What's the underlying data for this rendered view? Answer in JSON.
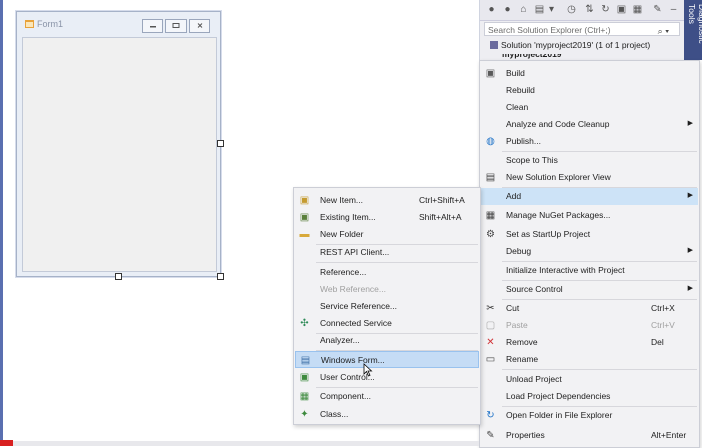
{
  "form": {
    "title": "Form1"
  },
  "solution_explorer": {
    "search_placeholder": "Search Solution Explorer (Ctrl+;)",
    "solution_label": "Solution 'myproject2019' (1 of 1 project)",
    "project_label": "myproject2019",
    "side_tab_label": "Diagnostic Tools"
  },
  "context_menu": {
    "items": [
      {
        "label": "Build",
        "icon": "build-icon"
      },
      {
        "label": "Rebuild"
      },
      {
        "label": "Clean"
      },
      {
        "label": "Analyze and Code Cleanup",
        "submenu": true
      },
      {
        "label": "Publish...",
        "icon": "globe-icon"
      },
      {
        "label": "Scope to This"
      },
      {
        "label": "New Solution Explorer View",
        "icon": "new-view-icon"
      },
      {
        "label": "Add",
        "submenu": true,
        "highlighted": true
      },
      {
        "label": "Manage NuGet Packages...",
        "icon": "nuget-icon"
      },
      {
        "label": "Set as StartUp Project",
        "icon": "gear-icon"
      },
      {
        "label": "Debug",
        "submenu": true
      },
      {
        "label": "Initialize Interactive with Project"
      },
      {
        "label": "Source Control",
        "submenu": true
      },
      {
        "label": "Cut",
        "shortcut": "Ctrl+X",
        "icon": "scissors-icon"
      },
      {
        "label": "Paste",
        "shortcut": "Ctrl+V",
        "icon": "paste-icon",
        "disabled": true
      },
      {
        "label": "Remove",
        "shortcut": "Del",
        "icon": "remove-icon"
      },
      {
        "label": "Rename",
        "icon": "rename-icon"
      },
      {
        "label": "Unload Project"
      },
      {
        "label": "Load Project Dependencies"
      },
      {
        "label": "Open Folder in File Explorer",
        "icon": "refresh-icon"
      },
      {
        "label": "Properties",
        "shortcut": "Alt+Enter",
        "icon": "wrench-icon"
      }
    ]
  },
  "add_submenu": {
    "items": [
      {
        "label": "New Item...",
        "shortcut": "Ctrl+Shift+A",
        "icon": "new-item-icon"
      },
      {
        "label": "Existing Item...",
        "shortcut": "Shift+Alt+A",
        "icon": "existing-item-icon"
      },
      {
        "label": "New Folder",
        "icon": "folder-icon"
      },
      {
        "label": "REST API Client..."
      },
      {
        "label": "Reference..."
      },
      {
        "label": "Web Reference...",
        "disabled": true
      },
      {
        "label": "Service Reference..."
      },
      {
        "label": "Connected Service",
        "icon": "connected-service-icon"
      },
      {
        "label": "Analyzer..."
      },
      {
        "label": "Windows Form...",
        "icon": "windows-form-icon",
        "highlighted": true
      },
      {
        "label": "User Control...",
        "icon": "user-control-icon"
      },
      {
        "label": "Component...",
        "icon": "component-icon"
      },
      {
        "label": "Class...",
        "icon": "class-icon"
      }
    ]
  },
  "colors": {
    "accent": "#3e4f87",
    "highlight": "#cde3f7",
    "menu_bg": "#f2f2f4"
  }
}
